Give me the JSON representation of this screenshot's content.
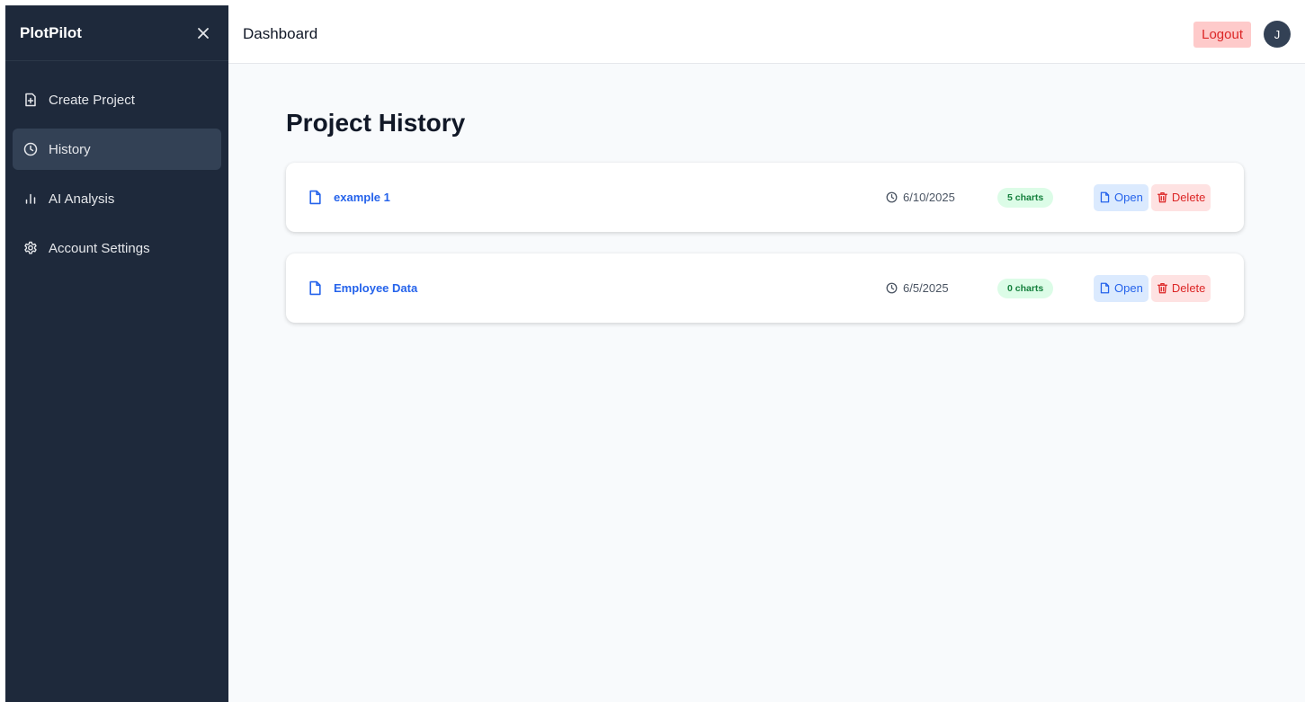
{
  "sidebar": {
    "brand": "PlotPilot",
    "close_icon": "close-icon",
    "items": [
      {
        "label": "Create Project",
        "icon": "file-plus-icon",
        "active": false
      },
      {
        "label": "History",
        "icon": "clock-icon",
        "active": true
      },
      {
        "label": "AI Analysis",
        "icon": "bar-chart-icon",
        "active": false
      },
      {
        "label": "Account Settings",
        "icon": "gear-icon",
        "active": false
      }
    ]
  },
  "header": {
    "title": "Dashboard",
    "logout_label": "Logout",
    "avatar_initial": "J"
  },
  "main": {
    "title": "Project History",
    "projects": [
      {
        "name": "example 1",
        "date": "6/10/2025",
        "charts": "5 charts",
        "open_label": "Open",
        "delete_label": "Delete"
      },
      {
        "name": "Employee Data",
        "date": "6/5/2025",
        "charts": "0 charts",
        "open_label": "Open",
        "delete_label": "Delete"
      }
    ]
  },
  "colors": {
    "sidebar_bg": "#1e293b",
    "active_item_bg": "#334155",
    "link_blue": "#2563eb",
    "danger_red": "#dc2626",
    "badge_green": "#15803d"
  }
}
